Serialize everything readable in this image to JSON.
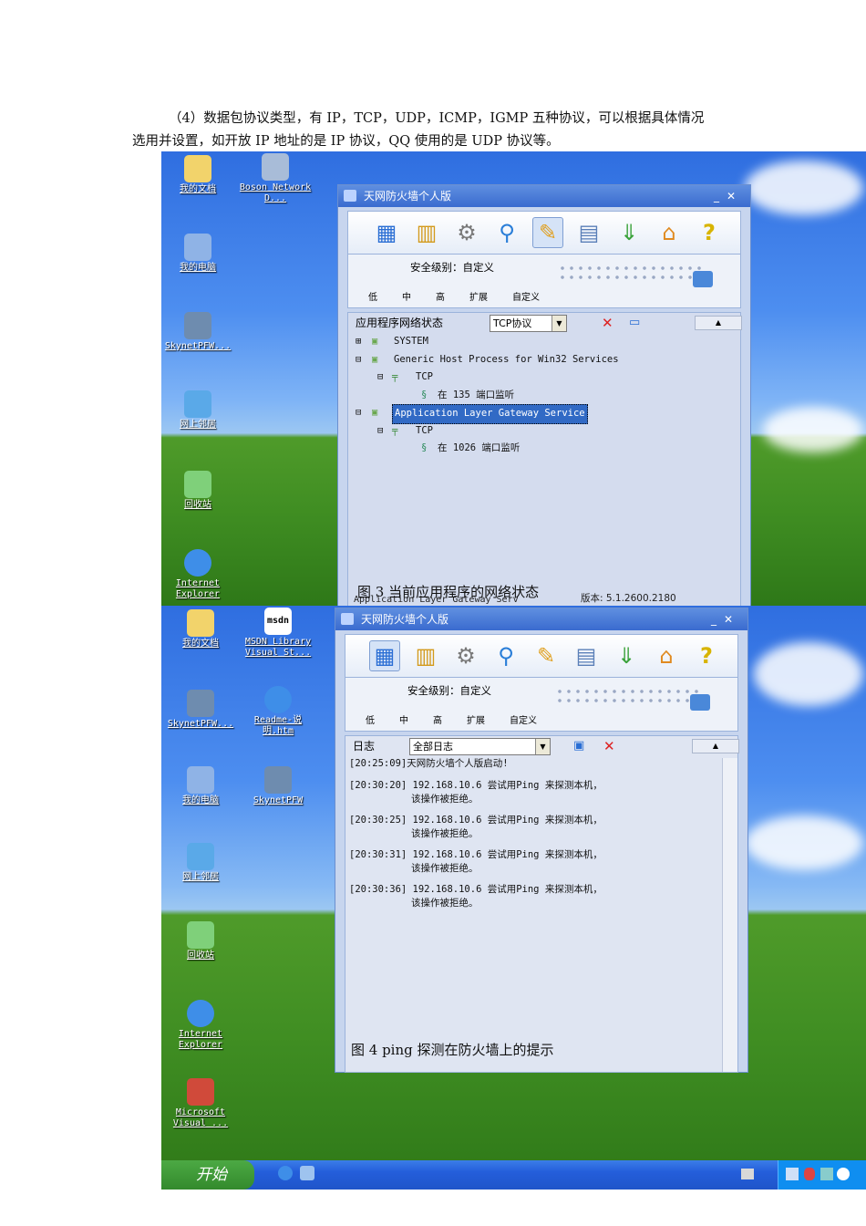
{
  "document": {
    "paragraph_line1": "（4）数据包协议类型，有 IP，TCP，UDP，ICMP，IGMP 五种协议，可以根据具体情况",
    "paragraph_line2": "选用并设置，如开放 IP 地址的是 IP 协议，QQ 使用的是 UDP 协议等。"
  },
  "figure3": {
    "desktop_icons": [
      "我的文档",
      "Boson Network D...",
      "我的电脑",
      "SkynetPFW...",
      "网上邻居",
      "回收站",
      "Internet Explorer"
    ],
    "window_title": "天网防火墙个人版",
    "security_level": "安全级别：自定义",
    "levels": [
      "低",
      "中",
      "高",
      "扩展",
      "自定义"
    ],
    "pane_title": "应用程序网络状态",
    "protocol_select": "TCP协议",
    "tree": [
      {
        "text": "SYSTEM"
      },
      {
        "text": "Generic Host Process for Win32 Services"
      },
      {
        "text": "TCP"
      },
      {
        "text": "在 135 端口监听"
      },
      {
        "text": "Application Layer Gateway Service"
      },
      {
        "text": "TCP"
      },
      {
        "text": "在 1026 端口监听"
      }
    ],
    "status_left": "Application Layer Gateway Serv",
    "status_version": "版本: 5.1.2600.2180",
    "caption": "图 3  当前应用程序的网络状态"
  },
  "figure4": {
    "desktop_icons": [
      "我的文档",
      "MSDN Library Visual St...",
      "SkynetPFW...",
      "Readme-说明.htm",
      "我的电脑",
      "SkynetPFW",
      "网上邻居",
      "回收站",
      "Internet Explorer",
      "Microsoft Visual ..."
    ],
    "msdn_logo": "msdn",
    "window_title": "天网防火墙个人版",
    "security_level": "安全级别：自定义",
    "levels": [
      "低",
      "中",
      "高",
      "扩展",
      "自定义"
    ],
    "pane_title": "日志",
    "log_select": "全部日志",
    "log_entries": [
      {
        "line1": "[20:25:09]天网防火墙个人版启动!",
        "line2": ""
      },
      {
        "line1": "[20:30:20] 192.168.10.6 尝试用Ping 来探测本机，",
        "line2": "该操作被拒绝。"
      },
      {
        "line1": "[20:30:25] 192.168.10.6 尝试用Ping 来探测本机，",
        "line2": "该操作被拒绝。"
      },
      {
        "line1": "[20:30:31] 192.168.10.6 尝试用Ping 来探测本机，",
        "line2": "该操作被拒绝。"
      },
      {
        "line1": "[20:30:36] 192.168.10.6 尝试用Ping 来探测本机，",
        "line2": "该操作被拒绝。"
      }
    ],
    "caption": "图 4 ping 探测在防火墙上的提示",
    "start_label": "开始"
  },
  "colors": {
    "title_blue": "#3a6bcf",
    "grass": "#3f8d22",
    "sky": "#4d8ef0",
    "highlight": "#316ac5"
  }
}
